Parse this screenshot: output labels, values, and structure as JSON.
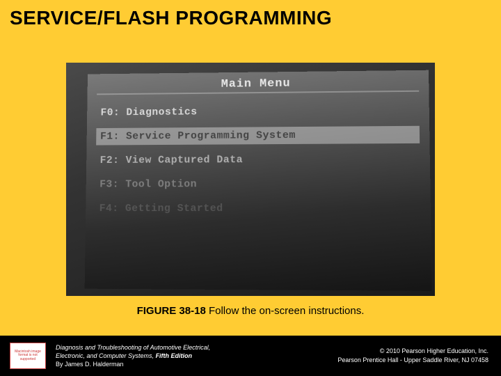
{
  "slide": {
    "title": "SERVICE/FLASH PROGRAMMING",
    "caption_fig": "FIGURE 38-18",
    "caption_text": " Follow the on-screen instructions."
  },
  "screen": {
    "header": "Main Menu",
    "items": [
      "F0: Diagnostics",
      "F1: Service Programming System",
      "F2: View Captured Data",
      "F3: Tool Option",
      "F4: Getting Started"
    ]
  },
  "thumbnail_text": "Macintosh image format is not supported",
  "book": {
    "line1": "Diagnosis and Troubleshooting of Automotive Electrical,",
    "line2": "Electronic, and Computer Systems,",
    "edition": " Fifth Edition",
    "author": "By James D. Halderman"
  },
  "copyright": {
    "line1": "© 2010 Pearson Higher Education, Inc.",
    "line2": "Pearson Prentice Hall - Upper Saddle River, NJ 07458"
  }
}
